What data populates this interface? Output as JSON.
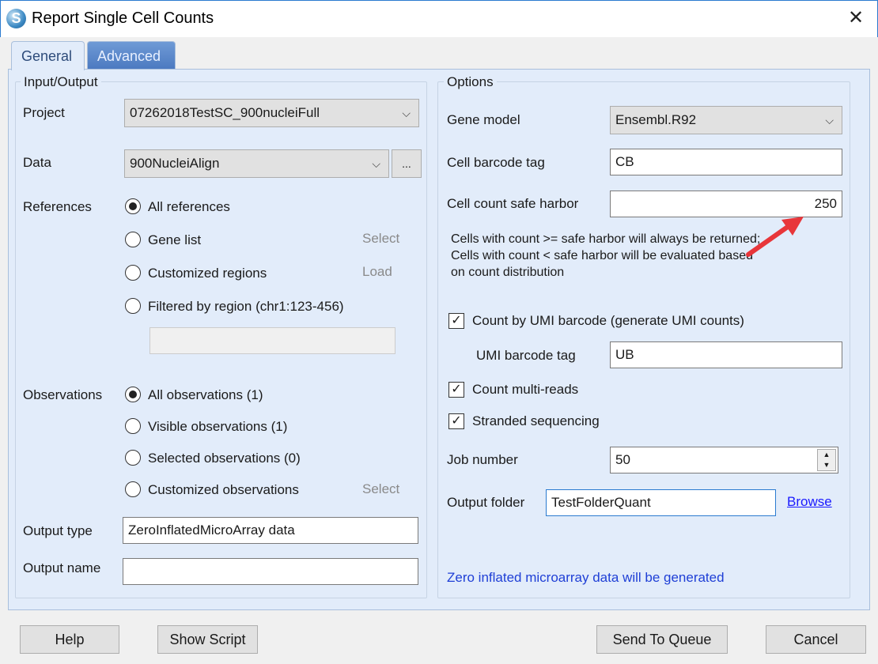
{
  "window": {
    "title": "Report Single Cell Counts",
    "close": "✕"
  },
  "tabs": [
    {
      "label": "General",
      "selected": true
    },
    {
      "label": "Advanced",
      "selected": false
    }
  ],
  "io": {
    "legend": "Input/Output",
    "project_label": "Project",
    "project_value": "07262018TestSC_900nucleiFull",
    "data_label": "Data",
    "data_value": "900NucleiAlign",
    "browse_dots": "...",
    "references_label": "References",
    "references": [
      {
        "label": "All references",
        "selected": true,
        "action": ""
      },
      {
        "label": "Gene list",
        "selected": false,
        "action": "Select"
      },
      {
        "label": "Customized regions",
        "selected": false,
        "action": "Load"
      },
      {
        "label": "Filtered by region (chr1:123-456)",
        "selected": false,
        "action": ""
      }
    ],
    "region_value": "",
    "observations_label": "Observations",
    "observations": [
      {
        "label": "All observations (1)",
        "selected": true,
        "action": ""
      },
      {
        "label": "Visible observations (1)",
        "selected": false,
        "action": ""
      },
      {
        "label": "Selected observations (0)",
        "selected": false,
        "action": ""
      },
      {
        "label": "Customized observations",
        "selected": false,
        "action": "Select"
      }
    ],
    "output_type_label": "Output type",
    "output_type_value": "ZeroInflatedMicroArray data",
    "output_name_label": "Output name",
    "output_name_value": ""
  },
  "options": {
    "legend": "Options",
    "gene_model_label": "Gene model",
    "gene_model_value": "Ensembl.R92",
    "cell_barcode_label": "Cell barcode tag",
    "cell_barcode_value": "CB",
    "safe_harbor_label": "Cell count safe harbor",
    "safe_harbor_value": "250",
    "safe_harbor_note": [
      "Cells with count >= safe harbor will always be returned;",
      "Cells with count < safe harbor will be evaluated based",
      "on count distribution"
    ],
    "umi_check_label": "Count by UMI barcode (generate UMI counts)",
    "umi_checked": true,
    "umi_tag_label": "UMI barcode tag",
    "umi_tag_value": "UB",
    "multi_reads_label": "Count multi-reads",
    "multi_reads_checked": true,
    "stranded_label": "Stranded sequencing",
    "stranded_checked": true,
    "job_number_label": "Job number",
    "job_number_value": "50",
    "output_folder_label": "Output folder",
    "output_folder_value": "TestFolderQuant",
    "browse_label": "Browse",
    "status": "Zero inflated microarray data will be generated"
  },
  "buttons": {
    "help": "Help",
    "show_script": "Show Script",
    "send_to_queue": "Send To Queue",
    "cancel": "Cancel"
  },
  "colors": {
    "accent": "#2b7bd0",
    "link": "#1a1aff",
    "status": "#1f3fd6",
    "arrow": "#e8363a",
    "panel": "#e2ecfa"
  }
}
